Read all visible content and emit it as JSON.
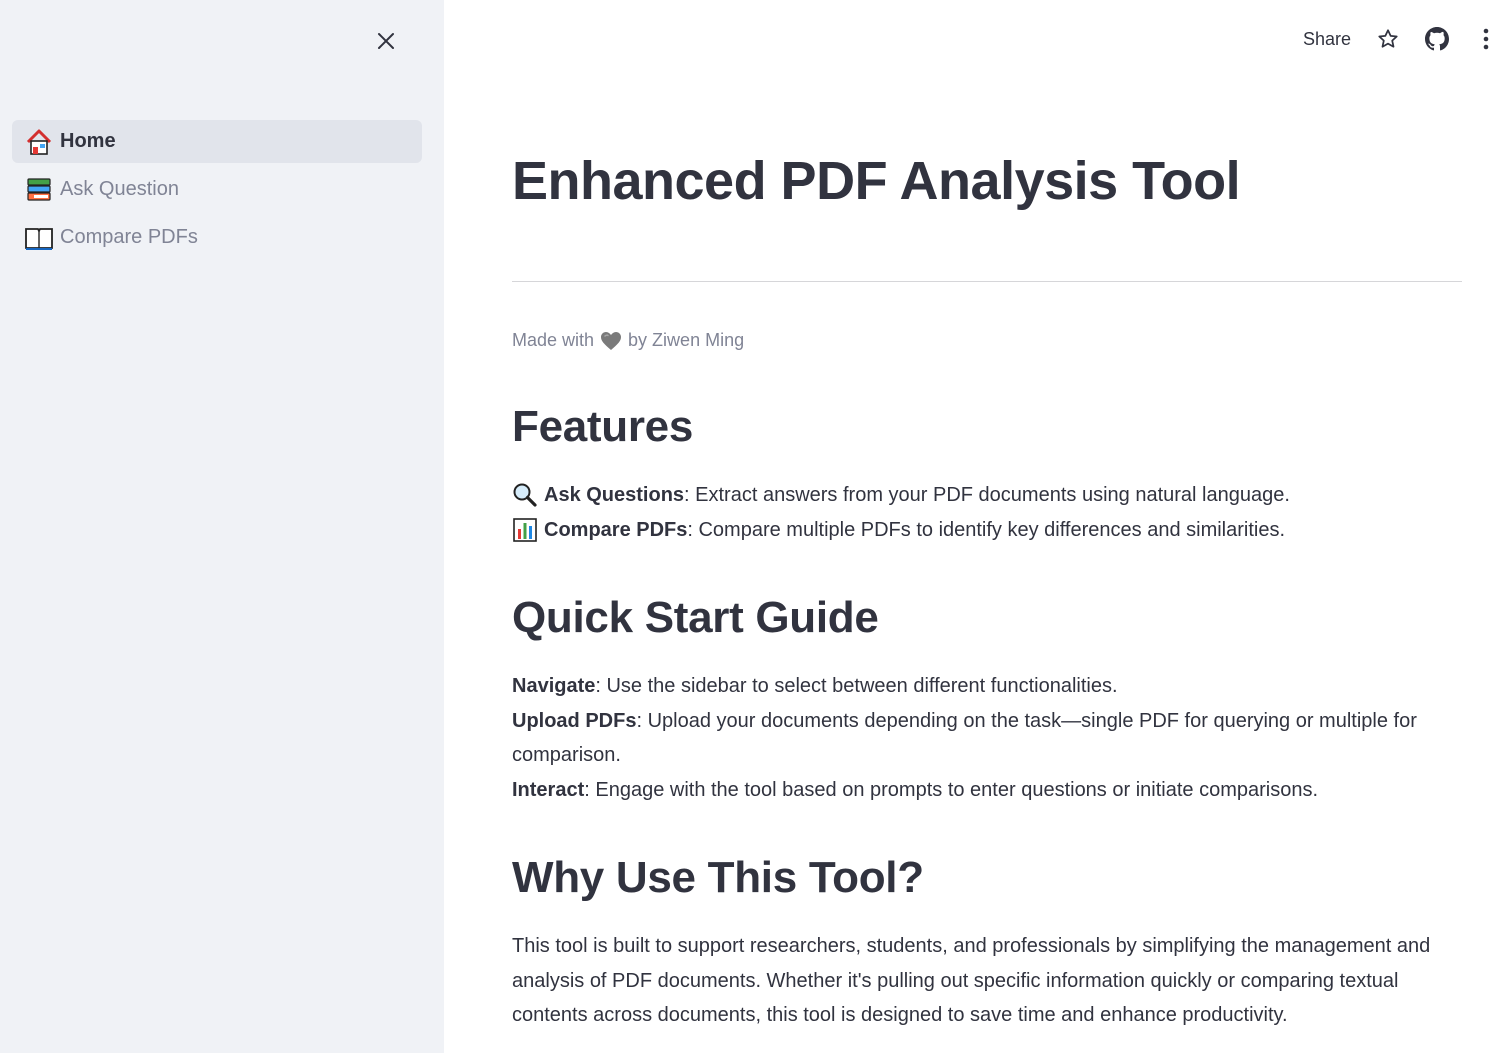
{
  "sidebar": {
    "items": [
      {
        "label": "Home",
        "icon": "house-icon",
        "active": true
      },
      {
        "label": "Ask Question",
        "icon": "books-icon",
        "active": false
      },
      {
        "label": "Compare PDFs",
        "icon": "open-book-icon",
        "active": false
      }
    ]
  },
  "toolbar": {
    "share_label": "Share",
    "icons": [
      "star-icon",
      "github-icon",
      "more-vertical-icon"
    ]
  },
  "main": {
    "title": "Enhanced PDF Analysis Tool",
    "made_with": {
      "prefix": "Made with",
      "suffix": "by Ziwen Ming",
      "icon": "heart-icon"
    },
    "features": {
      "heading": "Features",
      "items": [
        {
          "icon": "magnifier-icon",
          "bold": "Ask Questions",
          "text": ": Extract answers from your PDF documents using natural language."
        },
        {
          "icon": "bar-chart-icon",
          "bold": "Compare PDFs",
          "text": ": Compare multiple PDFs to identify key differences and similarities."
        }
      ]
    },
    "quick_start": {
      "heading": "Quick Start Guide",
      "items": [
        {
          "bold": "Navigate",
          "text": ": Use the sidebar to select between different functionalities."
        },
        {
          "bold": "Upload PDFs",
          "text": ": Upload your documents depending on the task—single PDF for querying or multiple for",
          "text_cont": "comparison."
        },
        {
          "bold": "Interact",
          "text": ": Engage with the tool based on prompts to enter questions or initiate comparisons."
        }
      ]
    },
    "why": {
      "heading": "Why Use This Tool?",
      "lines": [
        "This tool is built to support researchers, students, and professionals by simplifying the management and",
        "analysis of PDF documents. Whether it's pulling out specific information quickly or comparing textual",
        "contents across documents, this tool is designed to save time and enhance productivity."
      ]
    }
  },
  "colors": {
    "sidebar_bg": "#f0f2f6",
    "active_item_bg": "#e1e4eb",
    "text": "#31333f",
    "muted": "#808495"
  }
}
